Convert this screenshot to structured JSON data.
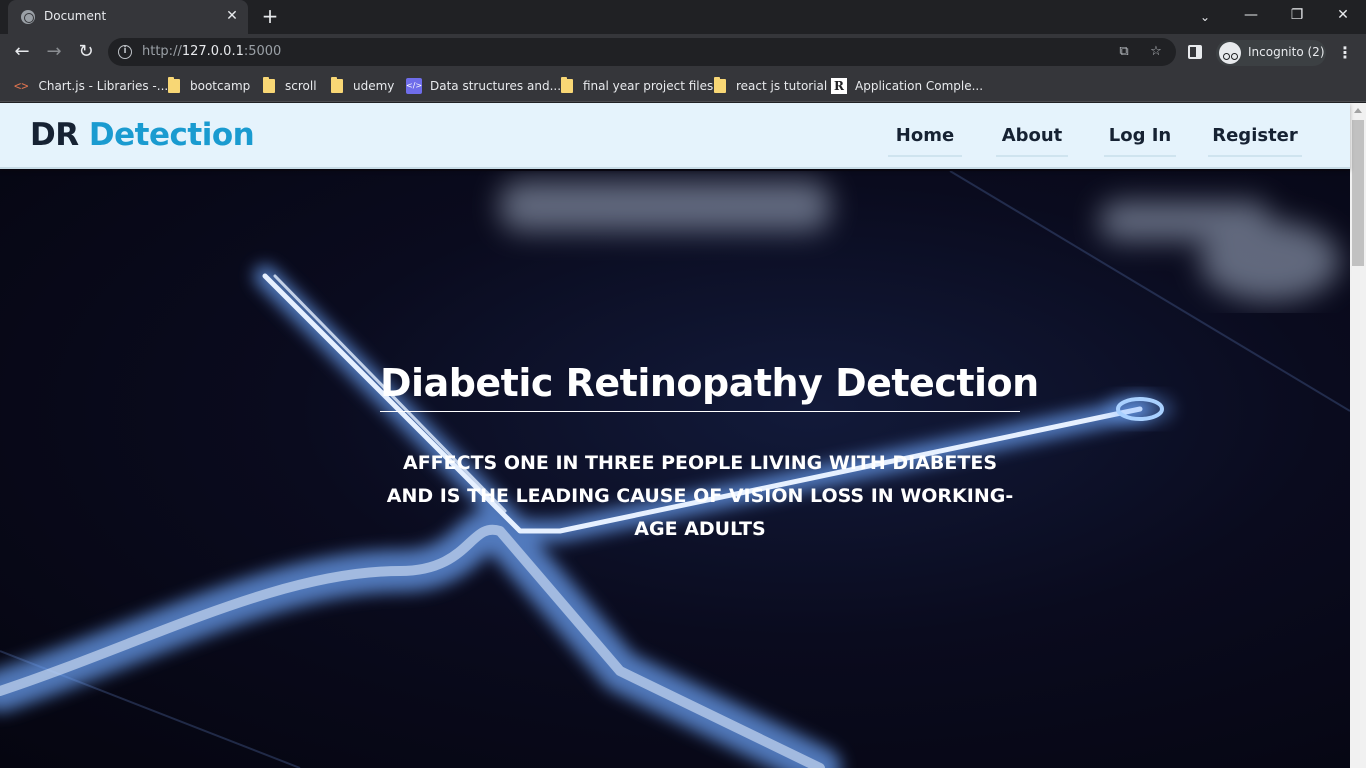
{
  "browser": {
    "tab_title": "Document",
    "url_prefix": "http://",
    "url_host": "127.0.0.1",
    "url_port": ":5000",
    "profile_label": "Incognito (2)",
    "bookmarks": [
      {
        "label": "Chart.js - Libraries -...",
        "icon": "code-icon"
      },
      {
        "label": "bootcamp",
        "icon": "folder-icon"
      },
      {
        "label": "scroll",
        "icon": "folder-icon"
      },
      {
        "label": "udemy",
        "icon": "folder-icon"
      },
      {
        "label": "Data structures and...",
        "icon": "code-square-icon"
      },
      {
        "label": "final year project files",
        "icon": "folder-icon"
      },
      {
        "label": "react js tutorial",
        "icon": "folder-icon"
      },
      {
        "label": "Application Comple...",
        "icon": "r-logo-icon"
      }
    ]
  },
  "site": {
    "logo_primary": "DR",
    "logo_accent": "Detection",
    "accent_color": "#1a9bd0",
    "nav": [
      {
        "label": "Home"
      },
      {
        "label": "About"
      },
      {
        "label": "Log In"
      },
      {
        "label": "Register"
      }
    ]
  },
  "hero": {
    "title": "Diabetic Retinopathy Detection",
    "subtitle": "AFFECTS ONE IN THREE PEOPLE LIVING WITH DIABETES AND IS THE LEADING CAUSE OF VISION LOSS IN WORKING-AGE ADULTS"
  }
}
